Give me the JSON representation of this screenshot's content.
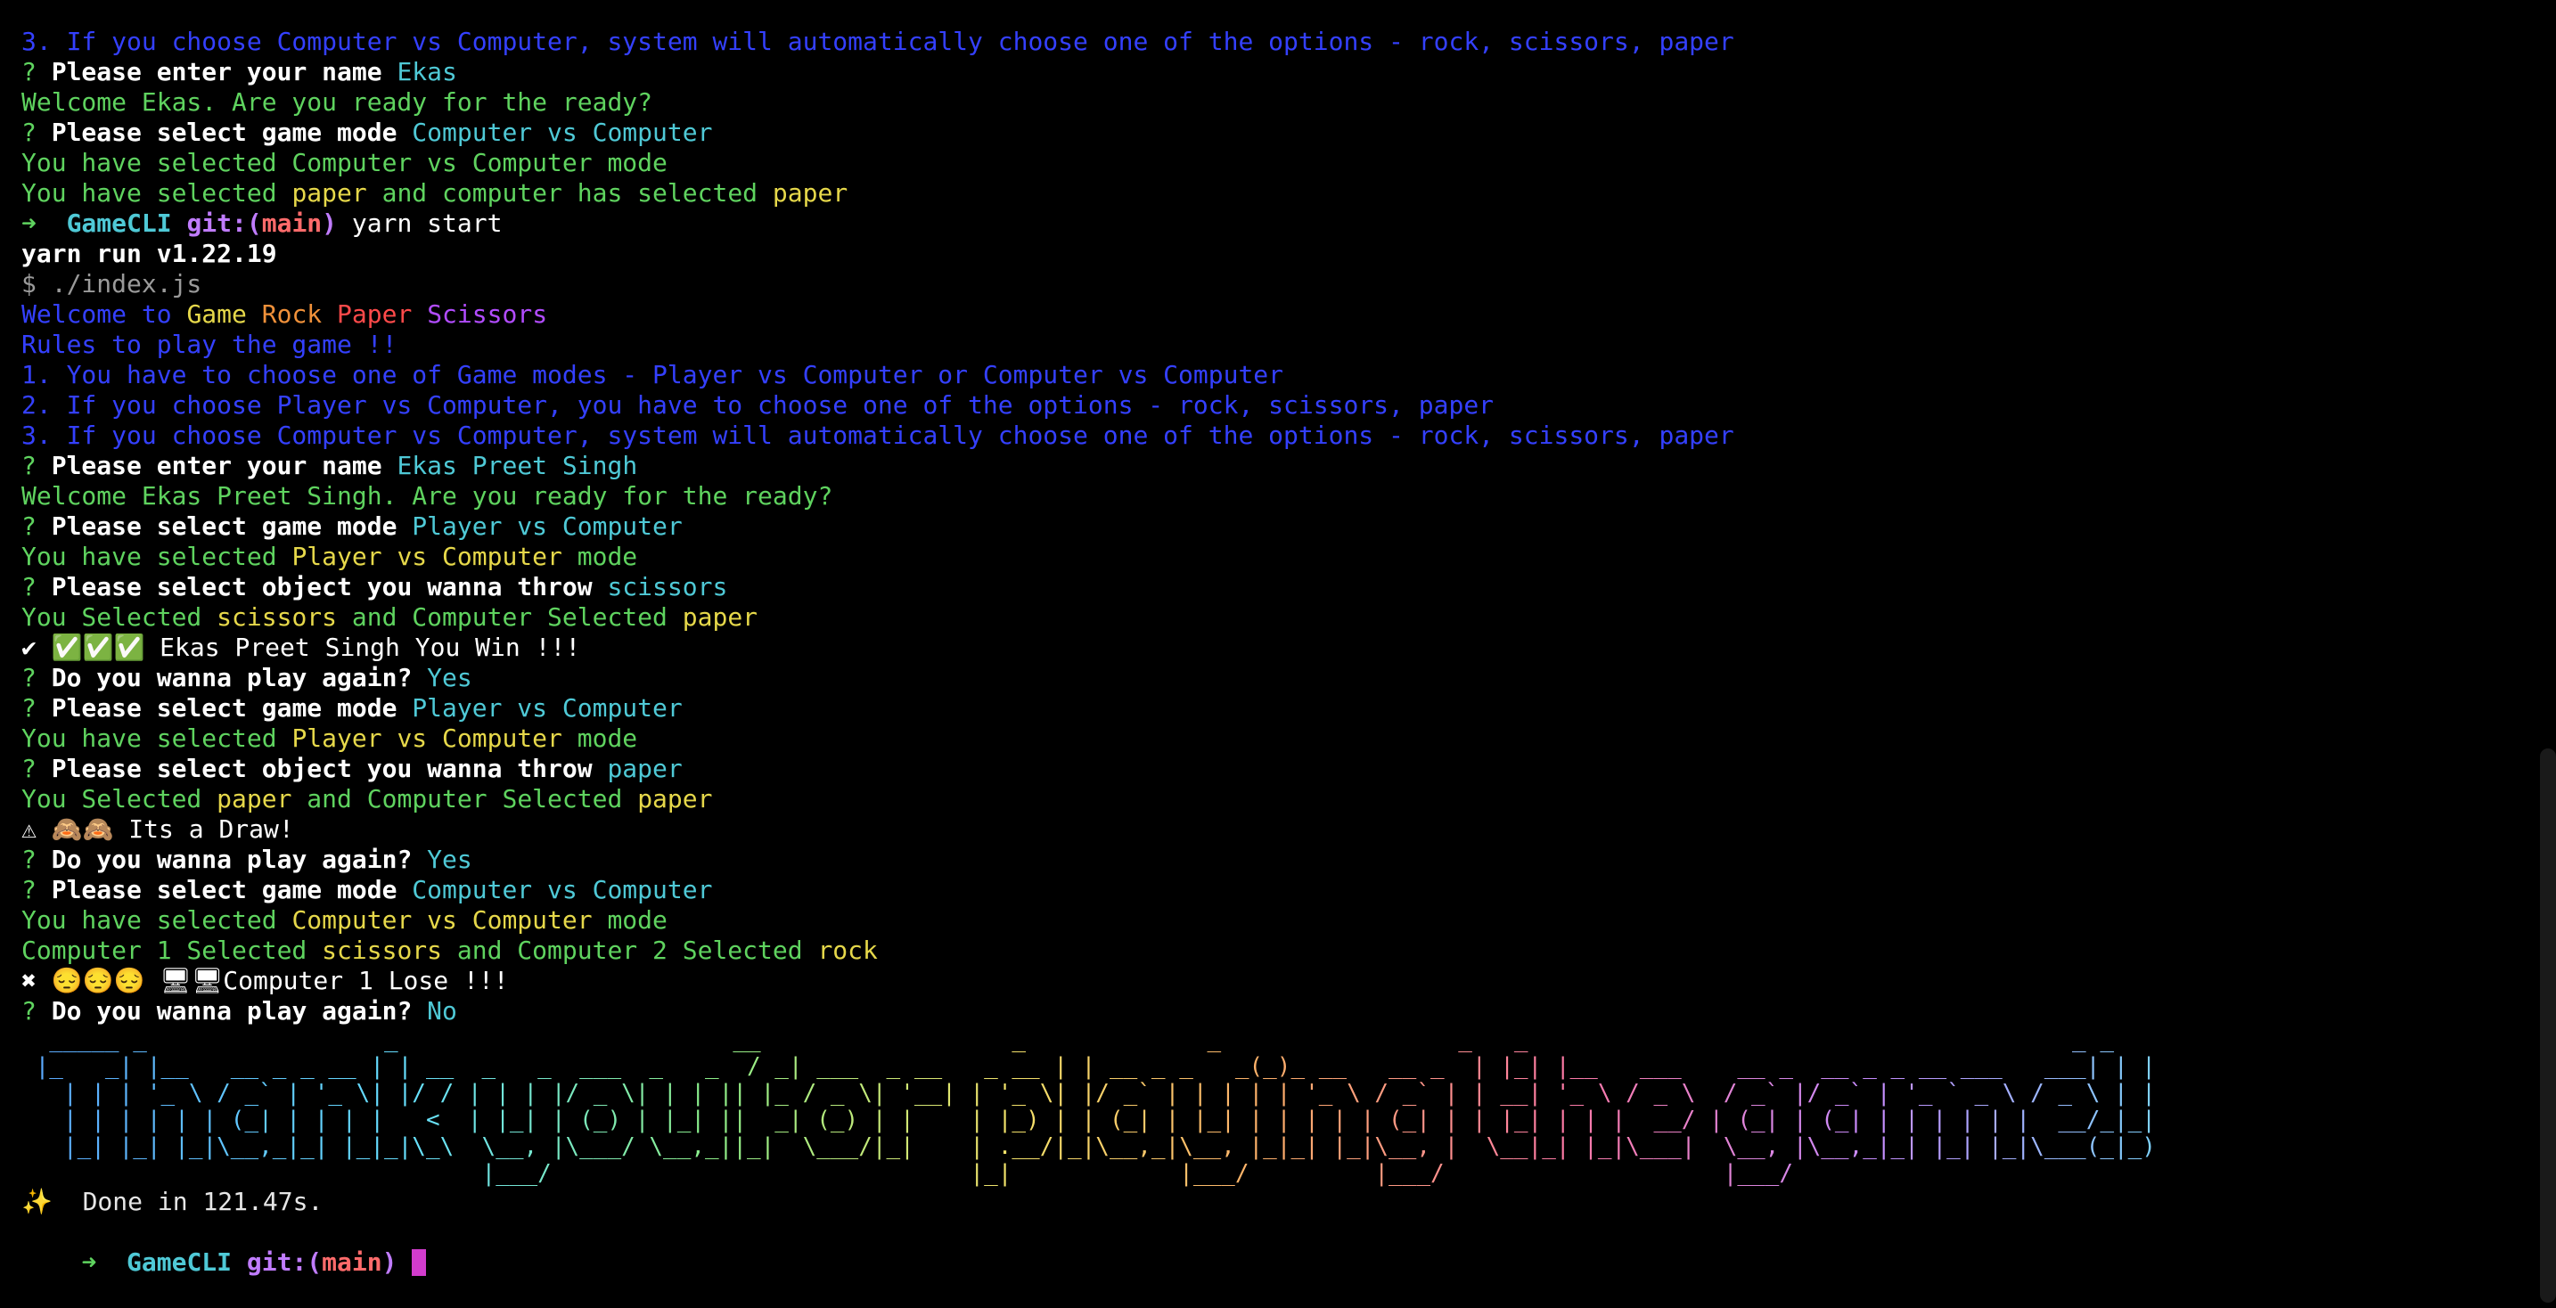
{
  "terminal": {
    "lines": [
      [
        {
          "t": "3. If you choose Computer vs Computer, system will automatically choose one of the options - rock, scissors, paper",
          "c": "blue"
        }
      ],
      [
        {
          "t": "? ",
          "c": "green"
        },
        {
          "t": "Please enter your name ",
          "c": "white b"
        },
        {
          "t": "Ekas",
          "c": "cyan"
        }
      ],
      [
        {
          "t": "Welcome Ekas. Are you ready for the ready?",
          "c": "green"
        }
      ],
      [
        {
          "t": "? ",
          "c": "green"
        },
        {
          "t": "Please select game mode ",
          "c": "white b"
        },
        {
          "t": "Computer vs Computer",
          "c": "cyan"
        }
      ],
      [
        {
          "t": "You have selected Computer vs Computer mode",
          "c": "green"
        }
      ],
      [
        {
          "t": "You have selected ",
          "c": "green"
        },
        {
          "t": "paper",
          "c": "yellow"
        },
        {
          "t": " and computer has selected ",
          "c": "green"
        },
        {
          "t": "paper",
          "c": "yellow"
        }
      ],
      [
        {
          "t": "➜  ",
          "c": "green b"
        },
        {
          "t": "GameCLI ",
          "c": "cyan b"
        },
        {
          "t": "git:(",
          "c": "violet b"
        },
        {
          "t": "main",
          "c": "gitred b"
        },
        {
          "t": ") ",
          "c": "violet b"
        },
        {
          "t": "yarn start",
          "c": "white"
        }
      ],
      [
        {
          "t": "yarn run v1.22.19",
          "c": "white b"
        }
      ],
      [
        {
          "t": "$ ./index.js",
          "c": "gray"
        }
      ],
      [
        {
          "t": "Welcome to ",
          "c": "blue"
        },
        {
          "t": "Game ",
          "c": "yellow"
        },
        {
          "t": "Rock ",
          "c": "orange"
        },
        {
          "t": "Paper ",
          "c": "red"
        },
        {
          "t": "Scissors",
          "c": "purple"
        }
      ],
      [
        {
          "t": "Rules to play the game !!",
          "c": "blue"
        }
      ],
      [
        {
          "t": "1. You have to choose one of Game modes - Player vs Computer or Computer vs Computer",
          "c": "blue"
        }
      ],
      [
        {
          "t": "2. If you choose Player vs Computer, you have to choose one of the options - rock, scissors, paper",
          "c": "blue"
        }
      ],
      [
        {
          "t": "3. If you choose Computer vs Computer, system will automatically choose one of the options - rock, scissors, paper",
          "c": "blue"
        }
      ],
      [
        {
          "t": "? ",
          "c": "green"
        },
        {
          "t": "Please enter your name ",
          "c": "white b"
        },
        {
          "t": "Ekas Preet Singh",
          "c": "cyan"
        }
      ],
      [
        {
          "t": "Welcome Ekas Preet Singh. Are you ready for the ready?",
          "c": "green"
        }
      ],
      [
        {
          "t": "? ",
          "c": "green"
        },
        {
          "t": "Please select game mode ",
          "c": "white b"
        },
        {
          "t": "Player vs Computer",
          "c": "cyan"
        }
      ],
      [
        {
          "t": "You have selected ",
          "c": "green"
        },
        {
          "t": "Player vs Computer",
          "c": "yellow"
        },
        {
          "t": " mode",
          "c": "green"
        }
      ],
      [
        {
          "t": "? ",
          "c": "green"
        },
        {
          "t": "Please select object you wanna throw ",
          "c": "white b"
        },
        {
          "t": "scissors",
          "c": "cyan"
        }
      ],
      [
        {
          "t": "You Selected ",
          "c": "green"
        },
        {
          "t": "scissors",
          "c": "yellow"
        },
        {
          "t": " and Computer Selected ",
          "c": "green"
        },
        {
          "t": "paper",
          "c": "yellow"
        }
      ],
      [
        {
          "t": "✔ ✅✅✅ Ekas Preet Singh You Win !!!",
          "c": "white"
        }
      ],
      [
        {
          "t": "? ",
          "c": "green"
        },
        {
          "t": "Do you wanna play again? ",
          "c": "white b"
        },
        {
          "t": "Yes",
          "c": "cyan"
        }
      ],
      [
        {
          "t": "? ",
          "c": "green"
        },
        {
          "t": "Please select game mode ",
          "c": "white b"
        },
        {
          "t": "Player vs Computer",
          "c": "cyan"
        }
      ],
      [
        {
          "t": "You have selected ",
          "c": "green"
        },
        {
          "t": "Player vs Computer",
          "c": "yellow"
        },
        {
          "t": " mode",
          "c": "green"
        }
      ],
      [
        {
          "t": "? ",
          "c": "green"
        },
        {
          "t": "Please select object you wanna throw ",
          "c": "white b"
        },
        {
          "t": "paper",
          "c": "cyan"
        }
      ],
      [
        {
          "t": "You Selected ",
          "c": "green"
        },
        {
          "t": "paper",
          "c": "yellow"
        },
        {
          "t": " and Computer Selected ",
          "c": "green"
        },
        {
          "t": "paper",
          "c": "yellow"
        }
      ],
      [
        {
          "t": "⚠ 🙈🙈 Its a Draw!",
          "c": "white"
        }
      ],
      [
        {
          "t": "? ",
          "c": "green"
        },
        {
          "t": "Do you wanna play again? ",
          "c": "white b"
        },
        {
          "t": "Yes",
          "c": "cyan"
        }
      ],
      [
        {
          "t": "? ",
          "c": "green"
        },
        {
          "t": "Please select game mode ",
          "c": "white b"
        },
        {
          "t": "Computer vs Computer",
          "c": "cyan"
        }
      ],
      [
        {
          "t": "You have selected ",
          "c": "green"
        },
        {
          "t": "Computer vs Computer",
          "c": "yellow"
        },
        {
          "t": " mode",
          "c": "green"
        }
      ],
      [
        {
          "t": "Computer 1 Selected ",
          "c": "green"
        },
        {
          "t": "scissors",
          "c": "yellow"
        },
        {
          "t": " and Computer 2 Selected ",
          "c": "green"
        },
        {
          "t": "rock",
          "c": "yellow"
        }
      ],
      [
        {
          "t": "✖ 😔😔😔 🖥🖥Computer 1 Lose !!!",
          "c": "white"
        }
      ],
      [
        {
          "t": "? ",
          "c": "green"
        },
        {
          "t": "Do you wanna play again? ",
          "c": "white b"
        },
        {
          "t": "No",
          "c": "cyan"
        }
      ]
    ],
    "banner_text": "Thank you for playing the game!!",
    "banner": [
      "  _____ _                 _                        __                  _             _                 _   _                                       _ _ ",
      " |_   _| |__   __ _ _ __ | | __  _   _  ___  _   _  / _| ___  _ __   _ __ | | __ _ _   _(_)_ __   __ _  | |_| |__   ___    __ _  __ _ _ __ ___   ___| | |",
      "   | | | '_ \\ / _` | '_ \\| |/ / | | | |/ _ \\| | | || |_ / _ \\| '__| | '_ \\| |/ _` | | | | | '_ \\ / _` | | __| '_ \\ / _ \\  / _` |/ _` | '_ ` _ \\ / _ \\ | |",
      "   | | | | | | (_| | | | |   <  | |_| | (_) | |_| ||  _| (_) | |    | |_) | | (_| | |_| | | | | | (_| | | |_| | | |  __/ | (_| | (_| | | | | | |  __/_|_|",
      "   |_| |_| |_|\\__,_|_| |_|_|\\_\\  \\__, |\\___/ \\__,_||_|  \\___/|_|    | .__/|_|\\__,_|\\__, |_|_| |_|\\__, |  \\__|_| |_|\\___|  \\__, |\\__,_|_| |_| |_|\\___(_|_)",
      "                                 |___/                              |_|            |___/         |___/                    |___/                           "
    ],
    "done": "✨  Done in 121.47s.",
    "prompt": {
      "arrow": "➜  ",
      "dir": "GameCLI ",
      "git_open": "git:(",
      "branch": "main",
      "git_close": ") "
    }
  }
}
